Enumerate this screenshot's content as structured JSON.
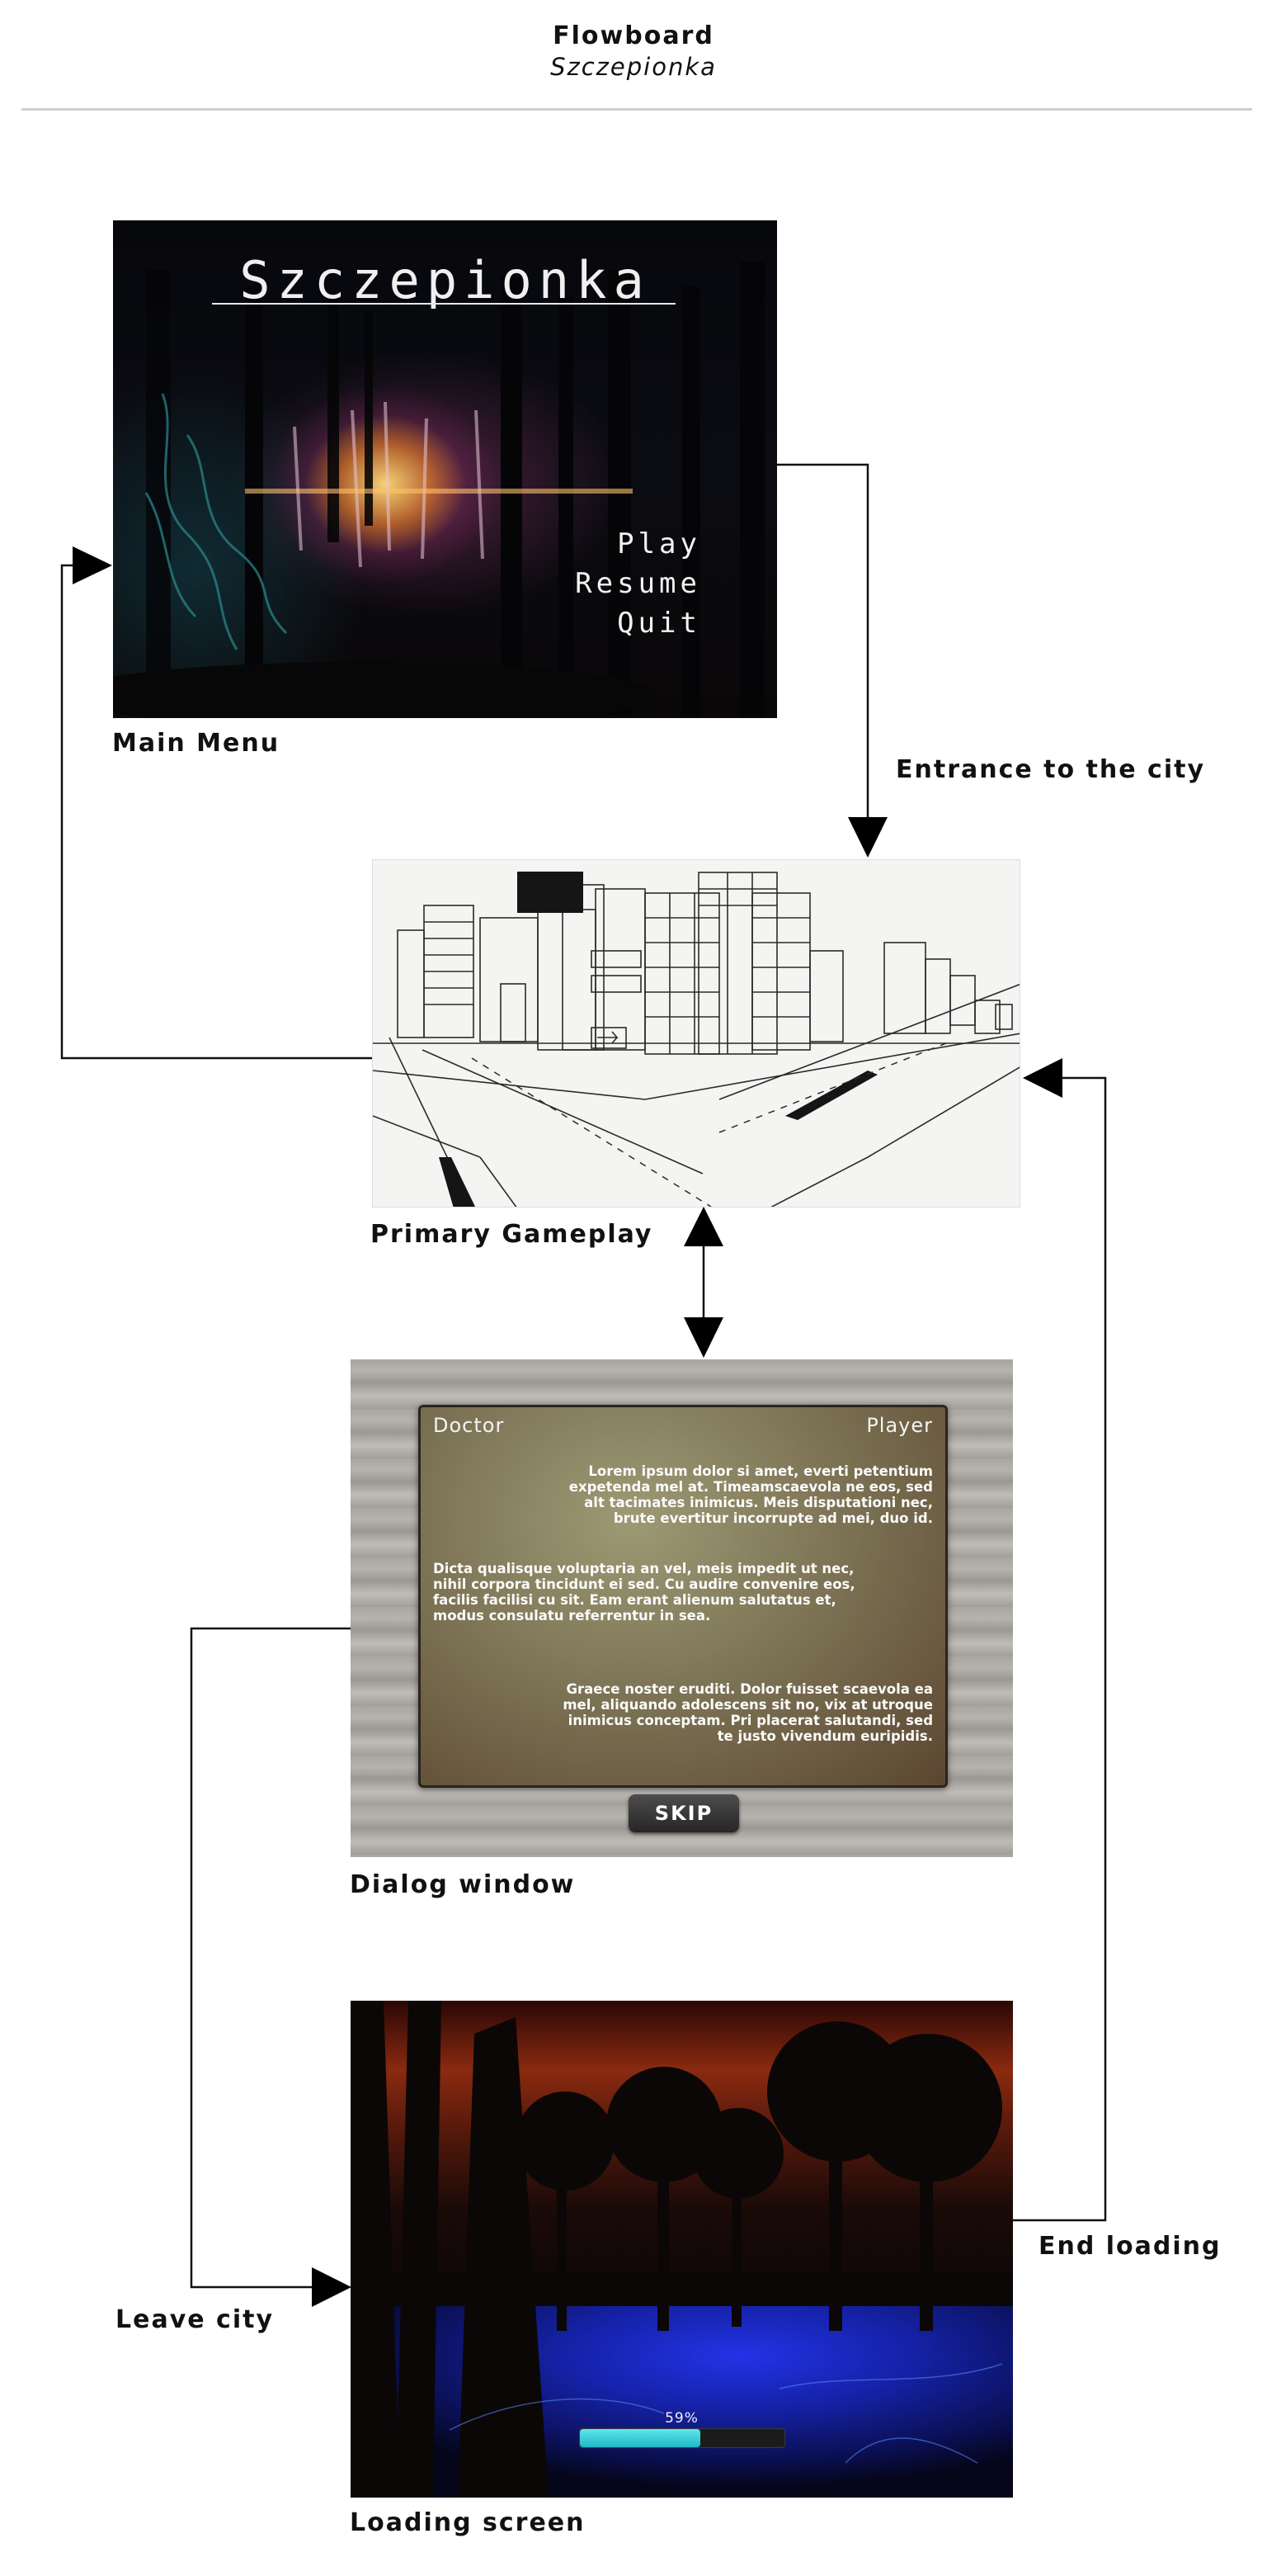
{
  "header": {
    "title": "Flowboard",
    "subtitle": "Szczepionka"
  },
  "screens": {
    "main_menu": {
      "caption": "Main Menu",
      "game_title": "Szczepionka",
      "menu": [
        "Play",
        "Resume",
        "Quit"
      ]
    },
    "gameplay": {
      "caption": "Primary Gameplay"
    },
    "dialog": {
      "caption": "Dialog window",
      "left_speaker": "Doctor",
      "right_speaker": "Player",
      "paragraphs": [
        "Lorem ipsum dolor si amet, everti petentium expetenda mel at. Timeamscaevola ne eos, sed alt tacimates inimicus. Meis disputationi nec, brute evertitur incorrupte ad mei, duo id.",
        "Dicta qualisque voluptaria an vel, meis impedit ut nec, nihil corpora tincidunt ei sed. Cu audire convenire eos, facilis facilisi cu sit. Eam erant alienum salutatus et, modus consulatu referrentur in sea.",
        "Graece noster eruditi. Dolor fuisset scaevola ea mel, aliquando adolescens sit no, vix at utroque inimicus conceptam. Pri placerat salutandi, sed te justo vivendum euripidis."
      ],
      "skip_label": "SKIP"
    },
    "loading": {
      "caption": "Loading screen",
      "progress_text": "59%",
      "progress_value": 0.59
    }
  },
  "edges": {
    "entrance": "Entrance to the city",
    "end_loading": "End loading",
    "leave_city": "Leave city"
  },
  "colors": {
    "progress_fill": "#2bc6d3",
    "lake": "#1f2fd6"
  }
}
